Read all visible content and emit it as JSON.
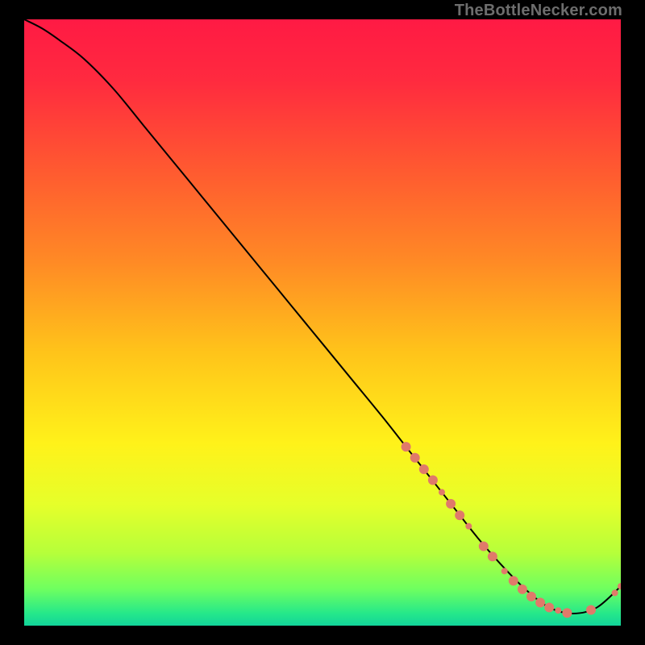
{
  "watermark": "TheBottleNecker.com",
  "gradient_stops": [
    {
      "offset": 0.0,
      "color": "#ff1a44"
    },
    {
      "offset": 0.1,
      "color": "#ff2a3f"
    },
    {
      "offset": 0.25,
      "color": "#ff5a30"
    },
    {
      "offset": 0.4,
      "color": "#ff8a25"
    },
    {
      "offset": 0.55,
      "color": "#ffc41a"
    },
    {
      "offset": 0.7,
      "color": "#fff21a"
    },
    {
      "offset": 0.8,
      "color": "#e6ff2a"
    },
    {
      "offset": 0.88,
      "color": "#b6ff3a"
    },
    {
      "offset": 0.94,
      "color": "#6eff60"
    },
    {
      "offset": 0.98,
      "color": "#25e88a"
    },
    {
      "offset": 1.0,
      "color": "#12d49a"
    }
  ],
  "chart_data": {
    "type": "line",
    "title": "",
    "xlabel": "",
    "ylabel": "",
    "xlim": [
      0,
      100
    ],
    "ylim": [
      0,
      100
    ],
    "series": [
      {
        "name": "curve",
        "x": [
          0,
          3,
          6,
          10,
          15,
          20,
          25,
          30,
          35,
          40,
          45,
          50,
          55,
          60,
          64,
          68,
          72,
          76,
          80,
          84,
          88,
          92,
          96,
          100
        ],
        "y": [
          100,
          98.5,
          96.5,
          93.5,
          88.5,
          82.5,
          76.5,
          70.5,
          64.5,
          58.5,
          52.5,
          46.5,
          40.5,
          34.5,
          29.5,
          24.5,
          19.5,
          14.5,
          10.0,
          6.0,
          3.0,
          2.0,
          3.0,
          6.5
        ]
      }
    ],
    "line_color": "#000000",
    "line_width": 2,
    "markers": {
      "color": "#e07a6a",
      "radius_small": 4,
      "radius_large": 6,
      "points": [
        {
          "x": 64.0,
          "y": 29.5,
          "r": "large"
        },
        {
          "x": 65.5,
          "y": 27.7,
          "r": "large"
        },
        {
          "x": 67.0,
          "y": 25.8,
          "r": "large"
        },
        {
          "x": 68.5,
          "y": 24.0,
          "r": "large"
        },
        {
          "x": 70.0,
          "y": 22.0,
          "r": "small"
        },
        {
          "x": 71.5,
          "y": 20.1,
          "r": "large"
        },
        {
          "x": 73.0,
          "y": 18.2,
          "r": "large"
        },
        {
          "x": 74.5,
          "y": 16.4,
          "r": "small"
        },
        {
          "x": 77.0,
          "y": 13.1,
          "r": "large"
        },
        {
          "x": 78.5,
          "y": 11.4,
          "r": "large"
        },
        {
          "x": 80.5,
          "y": 9.0,
          "r": "small"
        },
        {
          "x": 82.0,
          "y": 7.4,
          "r": "large"
        },
        {
          "x": 83.5,
          "y": 6.0,
          "r": "large"
        },
        {
          "x": 85.0,
          "y": 4.8,
          "r": "large"
        },
        {
          "x": 86.5,
          "y": 3.8,
          "r": "large"
        },
        {
          "x": 88.0,
          "y": 3.0,
          "r": "large"
        },
        {
          "x": 89.5,
          "y": 2.5,
          "r": "small"
        },
        {
          "x": 91.0,
          "y": 2.1,
          "r": "large"
        },
        {
          "x": 95.0,
          "y": 2.6,
          "r": "large"
        },
        {
          "x": 99.0,
          "y": 5.4,
          "r": "small"
        },
        {
          "x": 100.0,
          "y": 6.5,
          "r": "small"
        }
      ]
    }
  }
}
